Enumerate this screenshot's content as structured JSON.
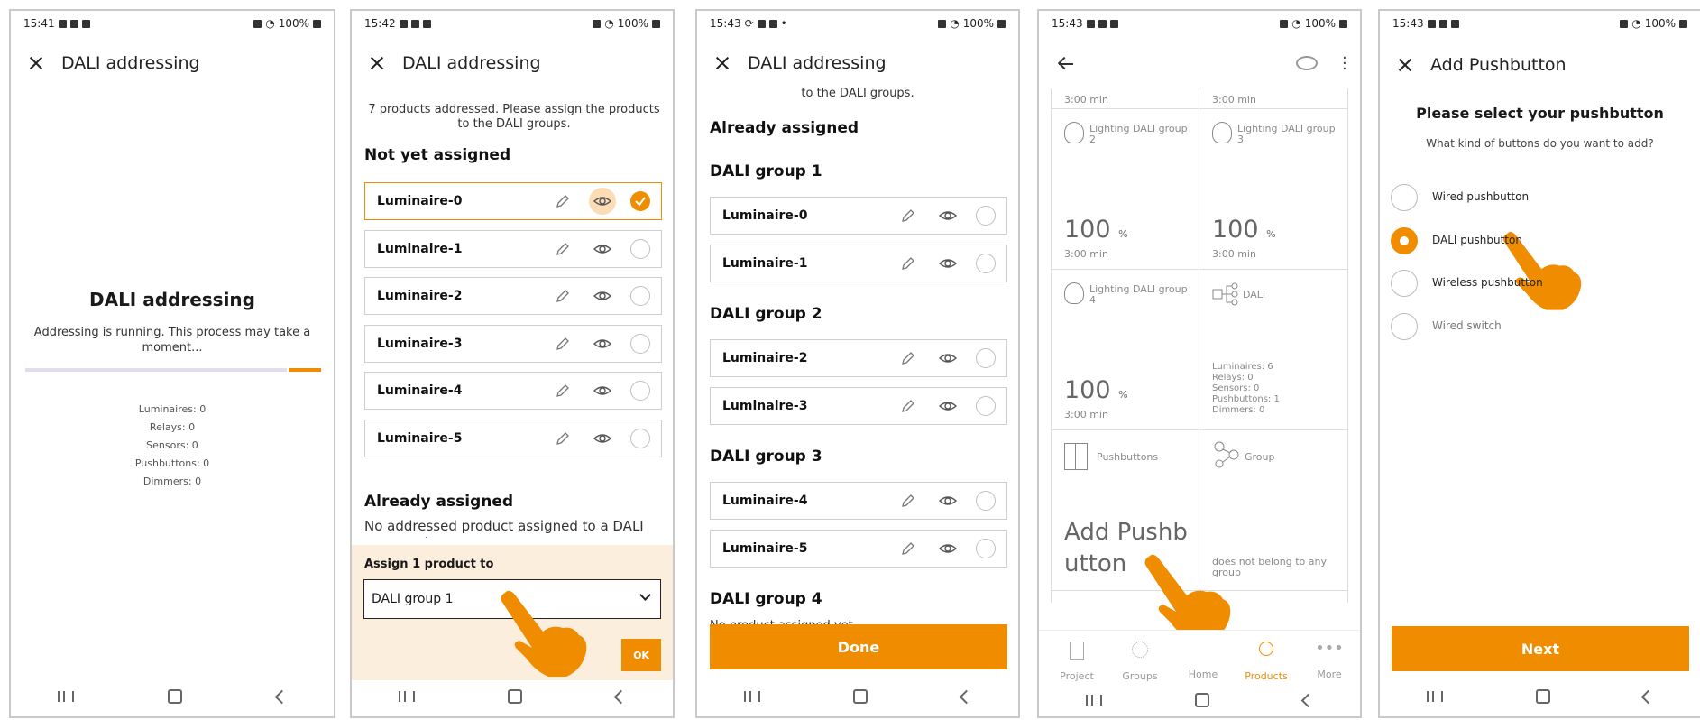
{
  "status": {
    "p1_time": "15:41",
    "p2_time": "15:42",
    "p3_time": "15:43",
    "p4_time": "15:43",
    "p5_time": "15:43",
    "battery": "100%"
  },
  "screen1": {
    "title": "DALI addressing",
    "heading": "DALI addressing",
    "message": "Addressing is running. This process may take a moment...",
    "stats": [
      "Luminaires: 0",
      "Relays: 0",
      "Sensors: 0",
      "Pushbuttons: 0",
      "Dimmers: 0"
    ]
  },
  "screen2": {
    "title": "DALI addressing",
    "intro": "7 products addressed. Please assign the products to the DALI groups.",
    "section_not_assigned": "Not yet assigned",
    "items": [
      "Luminaire-0",
      "Luminaire-1",
      "Luminaire-2",
      "Luminaire-3",
      "Luminaire-4",
      "Luminaire-5"
    ],
    "section_assigned": "Already assigned",
    "assigned_note": "No addressed product assigned to a DALI group yet",
    "assign_label": "Assign 1 product to",
    "select_value": "DALI group 1",
    "ok_label": "OK"
  },
  "screen3": {
    "title": "DALI addressing",
    "top_text": "to the DALI groups.",
    "section_assigned": "Already assigned",
    "groups": [
      {
        "name": "DALI group 1",
        "items": [
          "Luminaire-0",
          "Luminaire-1"
        ]
      },
      {
        "name": "DALI group 2",
        "items": [
          "Luminaire-2",
          "Luminaire-3"
        ]
      },
      {
        "name": "DALI group 3",
        "items": [
          "Luminaire-4",
          "Luminaire-5"
        ]
      },
      {
        "name": "DALI group 4",
        "items": []
      }
    ],
    "group4_note": "No product assigned yet",
    "done_label": "Done"
  },
  "screen4": {
    "top_left": "3:00 min",
    "top_right": "3:00 min",
    "tiles": [
      {
        "label": "Lighting DALI group 2",
        "value": "100",
        "unit": "%",
        "time": "3:00 min"
      },
      {
        "label": "Lighting DALI group 3",
        "value": "100",
        "unit": "%",
        "time": "3:00 min"
      },
      {
        "label": "Lighting DALI group 4",
        "value": "100",
        "unit": "%",
        "time": "3:00 min"
      }
    ],
    "dali_tile": {
      "label": "DALI",
      "stats": [
        "Luminaires: 6",
        "Relays: 0",
        "Sensors: 0",
        "Pushbuttons: 1",
        "Dimmers: 0"
      ]
    },
    "pushbuttons_tile": {
      "label": "Pushbuttons",
      "action_line1": "Add Pushb",
      "action_line2": "utton"
    },
    "group_tile": {
      "label": "Group",
      "note": "does not belong to any group"
    },
    "bottom_nav": [
      "Project",
      "Groups",
      "Home",
      "Products",
      "More"
    ],
    "active_nav": "Products"
  },
  "screen5": {
    "title": "Add Pushbutton",
    "heading": "Please select your pushbutton",
    "question": "What kind of buttons do you want to add?",
    "options": [
      "Wired pushbutton",
      "DALI pushbutton",
      "Wireless pushbutton",
      "Wired switch"
    ],
    "selected": "DALI pushbutton",
    "next_label": "Next"
  },
  "colors": {
    "accent": "#ef8c00",
    "accent_light": "#fbeedd",
    "border": "#cfcfcf"
  }
}
